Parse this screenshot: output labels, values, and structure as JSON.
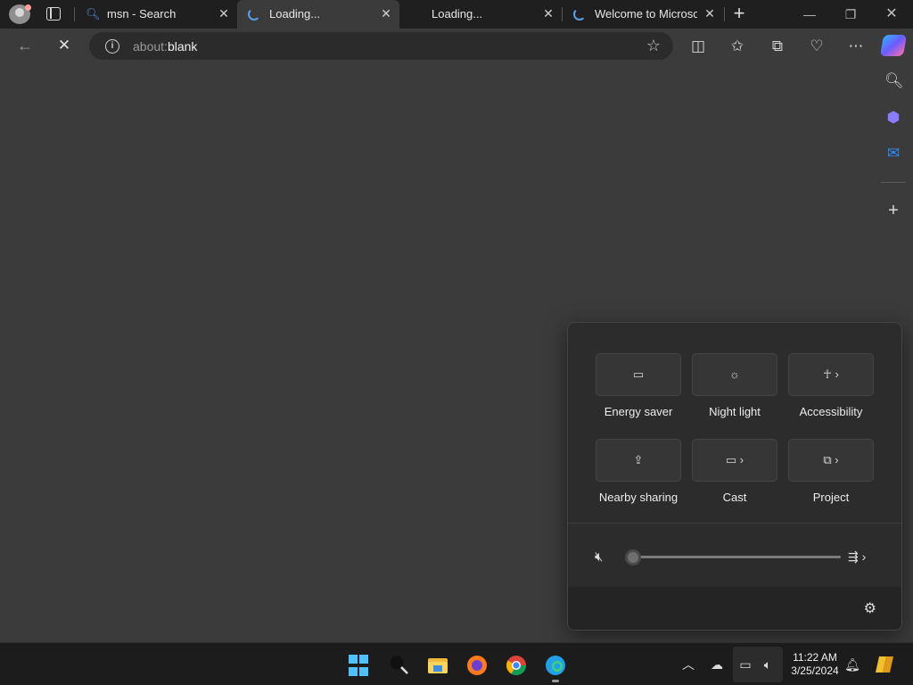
{
  "tabs": [
    {
      "label": "msn - Search",
      "icon": "search-icon",
      "active": false
    },
    {
      "label": "Loading...",
      "icon": "loading-spinner",
      "active": true
    },
    {
      "label": "Loading...",
      "icon": "",
      "active": false
    },
    {
      "label": "Welcome to Microsoft",
      "icon": "loading-spinner",
      "active": false
    }
  ],
  "address_bar": {
    "url_prefix": "about:",
    "url_main": "blank"
  },
  "quick_settings": {
    "tiles": [
      {
        "label": "Energy saver",
        "icon": "battery-leaf-icon",
        "has_chevron": false
      },
      {
        "label": "Night light",
        "icon": "brightness-icon",
        "has_chevron": false
      },
      {
        "label": "Accessibility",
        "icon": "accessibility-icon",
        "has_chevron": true
      },
      {
        "label": "Nearby sharing",
        "icon": "share-icon",
        "has_chevron": false
      },
      {
        "label": "Cast",
        "icon": "cast-icon",
        "has_chevron": true
      },
      {
        "label": "Project",
        "icon": "project-icon",
        "has_chevron": true
      }
    ],
    "volume": {
      "muted": true,
      "level": 0
    }
  },
  "taskbar": {
    "time": "11:22 AM",
    "date": "3/25/2024"
  },
  "colors": {
    "accent": "#4cc2ff",
    "page_bg": "#3b3b3b",
    "panel_bg": "#2c2c2c"
  }
}
